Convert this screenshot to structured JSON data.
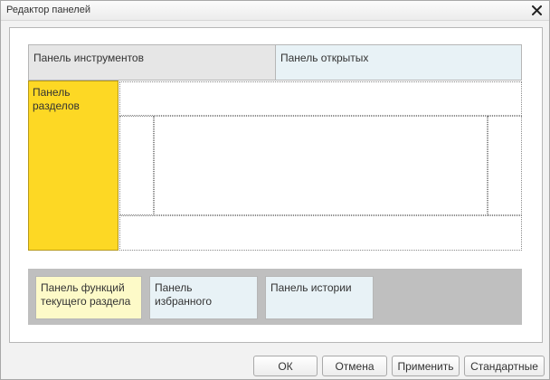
{
  "window": {
    "title": "Редактор панелей"
  },
  "panels": {
    "tools": "Панель инструментов",
    "open": "Панель открытых",
    "sections_line1": "Панель",
    "sections_line2": "разделов",
    "functions_line1": "Панель функций",
    "functions_line2": "текущего раздела",
    "favorites_line1": "Панель",
    "favorites_line2": "избранного",
    "history": "Панель истории"
  },
  "buttons": {
    "ok": "ОК",
    "cancel": "Отмена",
    "apply": "Применить",
    "standard": "Стандартные"
  },
  "colors": {
    "sections_panel": "#fdd824",
    "functions_panel": "#fdfac8",
    "light_blue_panel": "#e8f2f6",
    "tools_panel": "#e6e6e6",
    "bottom_area": "#bfbfbf"
  },
  "icons": {
    "close": "close-icon"
  }
}
